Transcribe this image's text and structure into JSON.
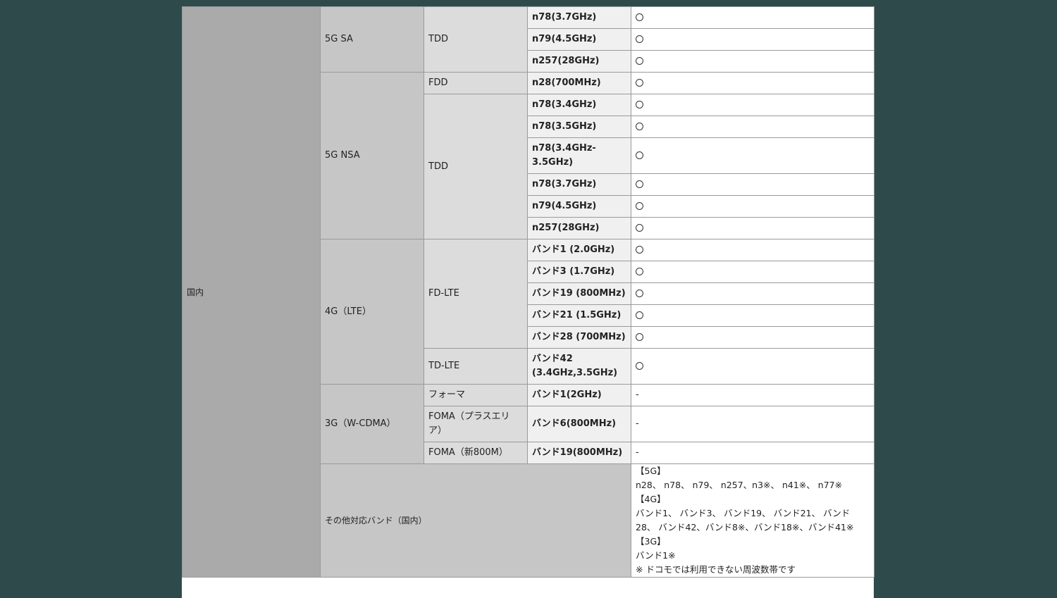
{
  "region_label": "国内",
  "generations": {
    "g5sa": "5G SA",
    "g5nsa": "5G NSA",
    "g4": "4G（LTE）",
    "g3": "3G（W-CDMA）"
  },
  "modes": {
    "tdd": "TDD",
    "fdd": "FDD",
    "fd_lte": "FD-LTE",
    "td_lte": "TD-LTE",
    "foma": "フォーマ",
    "foma_plus": "FOMA（プラスエリア）",
    "foma_800": "FOMA（新800M）"
  },
  "rows": [
    {
      "band": "n78(3.7GHz)",
      "mark": "○"
    },
    {
      "band": "n79(4.5GHz)",
      "mark": "○"
    },
    {
      "band": "n257(28GHz)",
      "mark": "○"
    },
    {
      "band": "n28(700MHz)",
      "mark": "○"
    },
    {
      "band": "n78(3.4GHz)",
      "mark": "○"
    },
    {
      "band": "n78(3.5GHz)",
      "mark": "○"
    },
    {
      "band": "n78(3.4GHz-3.5GHz)",
      "mark": "○"
    },
    {
      "band": "n78(3.7GHz)",
      "mark": "○"
    },
    {
      "band": "n79(4.5GHz)",
      "mark": "○"
    },
    {
      "band": "n257(28GHz)",
      "mark": "○"
    },
    {
      "band": "バンド1 (2.0GHz)",
      "mark": "○"
    },
    {
      "band": "バンド3 (1.7GHz)",
      "mark": "○"
    },
    {
      "band": "バンド19 (800MHz)",
      "mark": "○"
    },
    {
      "band": "バンド21 (1.5GHz)",
      "mark": "○"
    },
    {
      "band": "バンド28 (700MHz)",
      "mark": "○"
    },
    {
      "band": "バンド42 (3.4GHz,3.5GHz)",
      "mark": "○"
    },
    {
      "band": "バンド1(2GHz)",
      "mark": "-"
    },
    {
      "band": "バンド6(800MHz)",
      "mark": "-"
    },
    {
      "band": "バンド19(800MHz)",
      "mark": "-"
    }
  ],
  "other_bands": {
    "label": "その他対応バンド（国内）",
    "lines": [
      "【5G】",
      "n28、 n78、 n79、 n257、n3※、 n41※、 n77※",
      "【4G】",
      "バンド1、 バンド3、 バンド19、 バンド21、 バンド",
      "28、 バンド42、バンド8※、バンド18※、バンド41※",
      "【3G】",
      "バンド1※",
      "※ ドコモでは利用できない周波数帯です"
    ]
  }
}
